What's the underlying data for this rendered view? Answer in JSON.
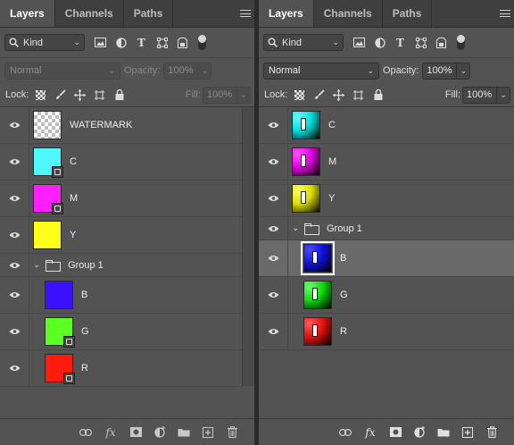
{
  "left_panel": {
    "tabs": [
      {
        "label": "Layers",
        "active": true
      },
      {
        "label": "Channels",
        "active": false
      },
      {
        "label": "Paths",
        "active": false
      }
    ],
    "filter": {
      "kind_label": "Kind"
    },
    "blend": {
      "mode": "Normal",
      "opacity_label": "Opacity:",
      "opacity_value": "100%",
      "disabled": true
    },
    "lock": {
      "label": "Lock:",
      "fill_label": "Fill:",
      "fill_value": "100%",
      "disabled_fill": true
    },
    "layers": [
      {
        "name": "WATERMARK",
        "thumb": "checker",
        "badge": false,
        "type": "layer"
      },
      {
        "name": "C",
        "thumb": "#4ff7ff",
        "badge": true,
        "type": "layer"
      },
      {
        "name": "M",
        "thumb": "#ff1fff",
        "badge": true,
        "type": "layer"
      },
      {
        "name": "Y",
        "thumb": "#ffff1a",
        "badge": false,
        "type": "layer"
      },
      {
        "name": "Group 1",
        "type": "group"
      },
      {
        "name": "B",
        "thumb": "#3a10ff",
        "badge": false,
        "type": "layer",
        "nested": true
      },
      {
        "name": "G",
        "thumb": "#5bff22",
        "badge": true,
        "type": "layer",
        "nested": true
      },
      {
        "name": "R",
        "thumb": "#ff1c0e",
        "badge": true,
        "type": "layer",
        "nested": true
      }
    ]
  },
  "right_panel": {
    "tabs": [
      {
        "label": "Layers",
        "active": true
      },
      {
        "label": "Channels",
        "active": false
      },
      {
        "label": "Paths",
        "active": false
      }
    ],
    "filter": {
      "kind_label": "Kind"
    },
    "blend": {
      "mode": "Normal",
      "opacity_label": "Opacity:",
      "opacity_value": "100%",
      "disabled": false
    },
    "lock": {
      "label": "Lock:",
      "fill_label": "Fill:",
      "fill_value": "100%",
      "disabled_fill": false
    },
    "layers": [
      {
        "name": "C",
        "thumb": "cyan",
        "type": "layer"
      },
      {
        "name": "M",
        "thumb": "magenta",
        "type": "layer"
      },
      {
        "name": "Y",
        "thumb": "yellow",
        "type": "layer"
      },
      {
        "name": "Group 1",
        "type": "group"
      },
      {
        "name": "B",
        "thumb": "blue",
        "type": "layer",
        "nested": true,
        "selected": true
      },
      {
        "name": "G",
        "thumb": "green",
        "type": "layer",
        "nested": true
      },
      {
        "name": "R",
        "thumb": "red",
        "type": "layer",
        "nested": true
      }
    ]
  },
  "colors": {
    "panel_bg": "#535353",
    "tabbar_bg": "#3f3f3f",
    "selected_row": "#6a6a6a"
  }
}
